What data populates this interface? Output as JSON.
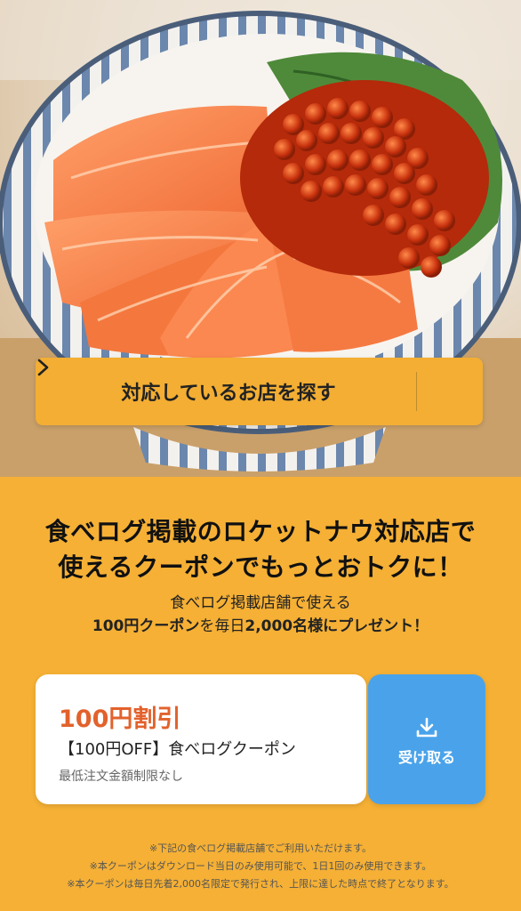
{
  "cta": {
    "label": "対応しているお店を探す"
  },
  "headline": {
    "line1": "食べログ掲載のロケットナウ対応店で",
    "line2": "使えるクーポンでもっとおトクに！"
  },
  "sub": {
    "line1": "食べログ掲載店舗で使える",
    "line2_part1": "100円クーポン",
    "line2_part2": "を毎日",
    "line2_part3": "2,000名様にプレゼント！"
  },
  "coupon": {
    "amount": "100円割引",
    "name": "【100円OFF】食べログクーポン",
    "condition": "最低注文金額制限なし"
  },
  "receive": {
    "label": "受け取る",
    "icon": "download-icon"
  },
  "notes": [
    "※下記の食べログ掲載店舗でご利用いただけます。",
    "※本クーポンはダウンロード当日のみ使用可能で、1日1回のみ使用できます。",
    "※本クーポンは毎日先着2,000名限定で発行され、上限に達した時点で終了となります。"
  ],
  "colors": {
    "background": "#f5b035",
    "accent_text": "#e2622c",
    "receive_button": "#4aa3ea",
    "cta_button": "#f3ae33"
  }
}
